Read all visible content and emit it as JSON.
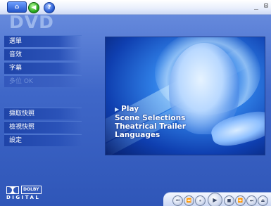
{
  "app": {
    "title": "DVD",
    "window_controls": "_ ⊡"
  },
  "menu_top": [
    {
      "label": "選單",
      "enabled": true
    },
    {
      "label": "音效",
      "enabled": true
    },
    {
      "label": "字幕",
      "enabled": true
    },
    {
      "label": "多位 OK",
      "enabled": false
    }
  ],
  "menu_bottom": [
    {
      "label": "擷取快照",
      "enabled": true
    },
    {
      "label": "檢視快照",
      "enabled": true
    },
    {
      "label": "設定",
      "enabled": true
    }
  ],
  "dvd_menu": {
    "items": [
      "Play",
      "Scene Selections",
      "Theatrical Trailer",
      "Languages"
    ],
    "selected": "Play"
  },
  "logo": {
    "word": "DOLBY",
    "sub": "DIGITAL"
  },
  "controls": [
    {
      "icon": "previous-icon",
      "glyph": "⏮"
    },
    {
      "icon": "rewind-icon",
      "glyph": "⏪"
    },
    {
      "icon": "pause-icon",
      "glyph": "⏸"
    },
    {
      "icon": "play-icon",
      "glyph": "▶"
    },
    {
      "icon": "stop-icon",
      "glyph": "■"
    },
    {
      "icon": "fast-forward-icon",
      "glyph": "⏩"
    },
    {
      "icon": "next-icon",
      "glyph": "⏭"
    },
    {
      "icon": "eject-icon",
      "glyph": "⏏"
    }
  ],
  "colors": {
    "background": "#3f67c8",
    "accent": "#1f44a8"
  }
}
